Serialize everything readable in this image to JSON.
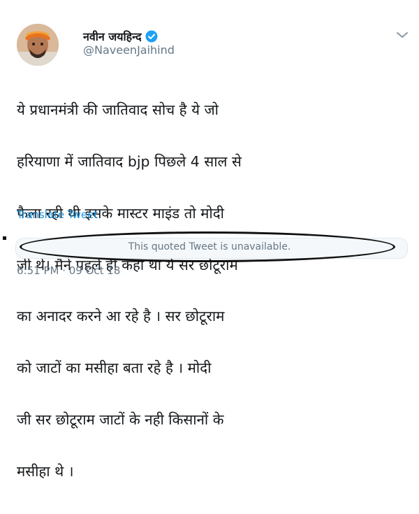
{
  "author": {
    "display_name": "नवीन जयहिन्द",
    "handle": "@NaveenJaihind",
    "verified": true
  },
  "tweet": {
    "text_lines": [
      "ये प्रधानमंत्री की जातिवाद सोच है ये जो",
      "हरियाणा में जातिवाद bjp पिछले 4 साल से",
      "फैला रही थी इसके मास्टर माइंड तो मोदी",
      "जी थे। मैने पहले ही कहा था ये सर छोटूराम",
      "का अनादर करने आ रहे है । सर छोटूराम",
      "को जाटों का मसीहा बता रहे है । मोदी",
      "जी सर छोटूराम जाटों के नही किसानों के",
      "मसीहा थे ।"
    ],
    "translate_label": "Translate Tweet",
    "quoted_tweet_message": "This quoted Tweet is unavailable.",
    "timestamp": "6:51 PM · 09 Oct 18"
  },
  "icons": {
    "verified": "verified-badge-icon",
    "menu": "chevron-down-icon"
  },
  "colors": {
    "link": "#1b95e0",
    "verified_badge": "#1da1f2",
    "secondary_text": "#657786",
    "primary_text": "#14171a",
    "annotation_oval": "#111111"
  }
}
